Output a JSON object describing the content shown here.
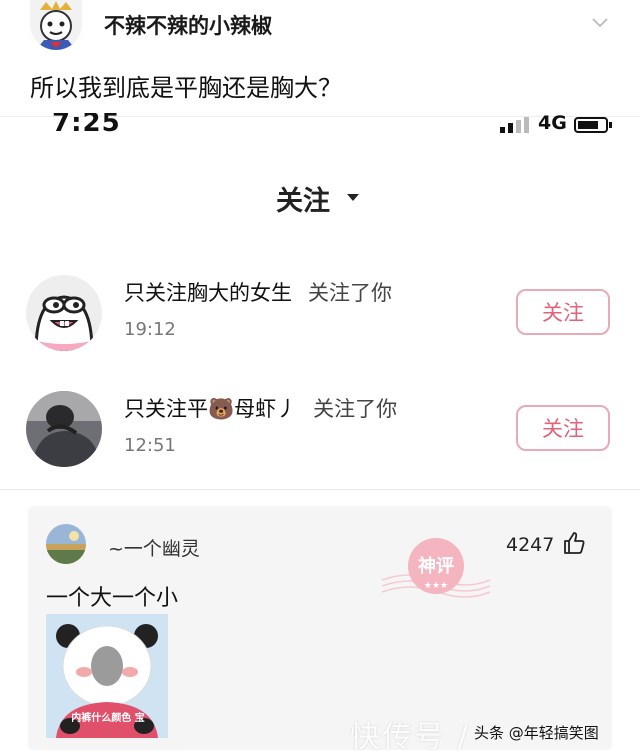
{
  "post": {
    "author": "不辣不辣的小辣椒",
    "text": "所以我到底是平胸还是胸大？"
  },
  "screenshot": {
    "status_time": "7:25",
    "network": "4G",
    "title": "关注",
    "follows": [
      {
        "name": "只关注胸大的女生",
        "action": "关注了你",
        "time": "19:12",
        "button": "关注"
      },
      {
        "name": "只关注平🐻母虾丿",
        "action": "关注了你",
        "time": "12:51",
        "button": "关注"
      }
    ]
  },
  "comment": {
    "user": "~一个幽灵",
    "likes": "4247",
    "text": "一个大一个小",
    "image_caption": "内裤什么颜色 宝",
    "stamp_text": "神评"
  },
  "footer": {
    "watermark": "快传号 /",
    "credit": "头条 @年轻搞笑图"
  },
  "colors": {
    "button_border": "#e8aab4",
    "button_text": "#e0637a",
    "stamp": "#f4b5c1"
  },
  "icons": [
    "chevron-down-icon",
    "caret-down-icon",
    "signal-icon",
    "battery-icon",
    "thumbs-up-icon"
  ]
}
